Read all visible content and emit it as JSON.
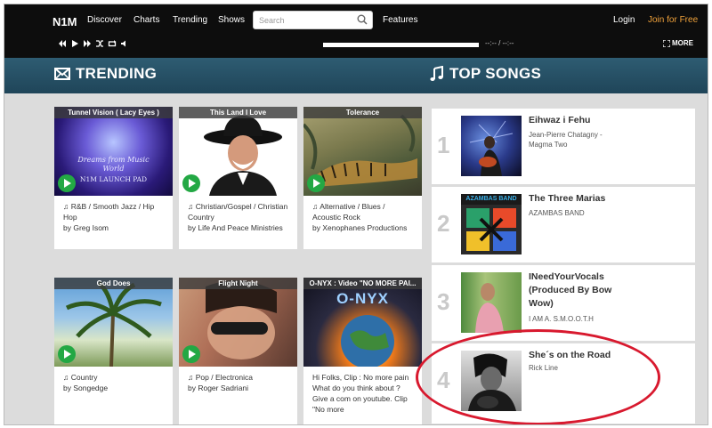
{
  "nav": {
    "logo": "N1M",
    "links": [
      "Discover",
      "Charts",
      "Trending",
      "Shows"
    ],
    "search_placeholder": "Search",
    "features": "Features",
    "login": "Login",
    "join": "Join for Free",
    "time": "--:-- / --:--",
    "more": "MORE"
  },
  "sections": {
    "trending": "TRENDING",
    "top_songs": "TOP SONGS"
  },
  "trending": [
    {
      "title": "Tunnel Vision ( Lacy Eyes )",
      "genre": "R&B / Smooth Jazz / Hip Hop",
      "by": "by Greg Isom",
      "overlay1": "Dreams from Music",
      "overlay2": "World",
      "overlay3": "N1M LAUNCH PAD"
    },
    {
      "title": "This Land I Love",
      "genre": "Christian/Gospel / Christian Country",
      "by": "by Life And Peace Ministries"
    },
    {
      "title": "Tolerance",
      "genre": "Alternative / Blues / Acoustic Rock",
      "by": "by Xenophanes Productions"
    },
    {
      "title": "God Does",
      "genre": "Country",
      "by": "by Songedge"
    },
    {
      "title": "Flight Night",
      "genre": "Pop / Electronica",
      "by": "by Roger Sadriani"
    },
    {
      "title": "O-NYX : Video \"NO MORE PAI...",
      "desc": "Hi Folks, Clip : No more pain What do you think about ? Give a com on youtube. Clip \"No more",
      "overlay": "O-NYX"
    }
  ],
  "songs": [
    {
      "rank": "1",
      "title": "Eihwaz i Fehu",
      "artist": "Jean-Pierre Chatagny - Magma Two"
    },
    {
      "rank": "2",
      "title": "The Three Marias",
      "artist": "AZAMBAS BAND",
      "cover_text": "AZAMBAS BAND"
    },
    {
      "rank": "3",
      "title": "INeedYourVocals (Produced By Bow Wow)",
      "artist": "I AM A. S.M.O.O.T.H"
    },
    {
      "rank": "4",
      "title": "She´s on the Road",
      "artist": "Rick Line"
    }
  ],
  "colors": {
    "accent_orange": "#f0a23b",
    "header_teal": "#2a5469",
    "play_green": "#23a844",
    "annotation_red": "#d8192e"
  }
}
